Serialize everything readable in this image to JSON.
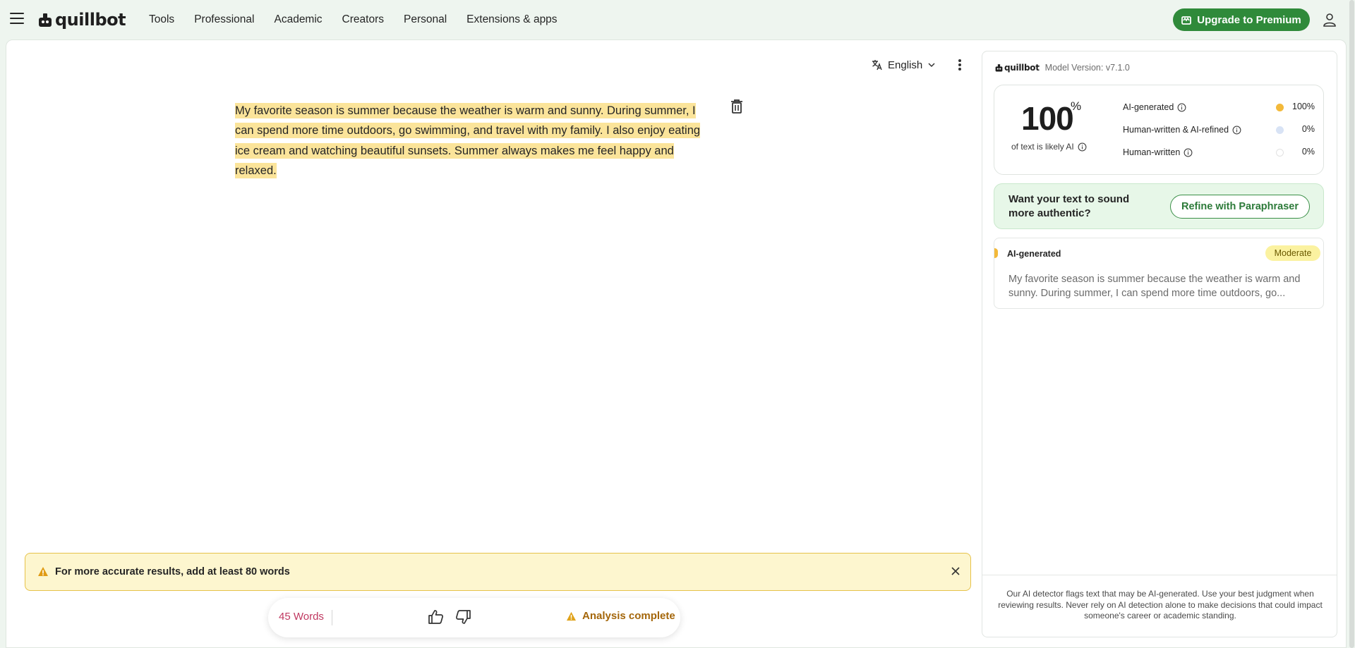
{
  "header": {
    "logo_text": "quillbot",
    "nav": [
      "Tools",
      "Professional",
      "Academic",
      "Creators",
      "Personal",
      "Extensions & apps"
    ],
    "upgrade_label": "Upgrade to Premium"
  },
  "editor": {
    "language": "English",
    "text": "My favorite season is summer because the weather is warm and sunny. During summer, I can spend more time outdoors, go swimming, and travel with my family. I also enjoy eating ice cream and watching beautiful sunsets. Summer always makes me feel happy and relaxed.",
    "warning": "For more accurate results, add at least 80 words",
    "word_count": "45 Words",
    "status": "Analysis complete",
    "highlight_color": "#fbe49a"
  },
  "results": {
    "brand": "quillbot",
    "model_version": "Model Version: v7.1.0",
    "score": "100",
    "score_unit": "%",
    "score_caption": "of text is likely AI",
    "breakdown": [
      {
        "label": "AI-generated",
        "value": "100%",
        "color": "#f3b93a"
      },
      {
        "label": "Human-written & AI-refined",
        "value": "0%",
        "color": "#d8e3f5"
      },
      {
        "label": "Human-written",
        "value": "0%",
        "color": "#ffffff"
      }
    ],
    "refine_prompt": "Want your text to sound more authentic?",
    "refine_button": "Refine with Paraphraser",
    "segment": {
      "title": "AI-generated",
      "badge": "Moderate",
      "excerpt": "My favorite season is summer because the weather is warm and sunny. During summer, I can spend more time outdoors, go..."
    },
    "disclaimer": "Our AI detector flags text that may be AI-generated. Use your best judgment when reviewing results. Never rely on AI detection alone to make decisions that could impact someone's career or academic standing."
  },
  "colors": {
    "brand_green": "#2f8a3a",
    "warning_bg": "#fdf6cf",
    "word_count": "#c03961",
    "status": "#a4660a"
  },
  "icons": [
    "menu-icon",
    "quillbot-logo-icon",
    "crown-icon",
    "user-icon",
    "translate-icon",
    "chevron-down-icon",
    "more-vertical-icon",
    "trash-icon",
    "warning-icon",
    "close-icon",
    "thumbs-up-icon",
    "thumbs-down-icon",
    "info-icon"
  ]
}
